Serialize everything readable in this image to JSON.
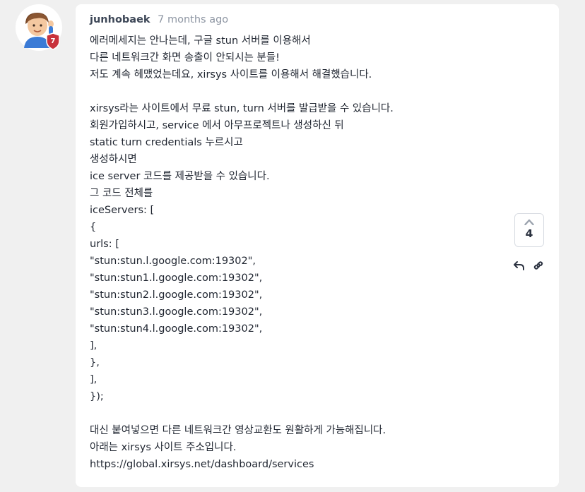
{
  "post": {
    "author": "junhobaek",
    "timestamp": "7 months ago",
    "avatar_badge": "7",
    "lines": [
      "에러메세지는 안나는데, 구글 stun 서버를 이용해서",
      "다른 네트워크간 화면 송출이 안되시는 분들!",
      "저도 계속 헤맸었는데요, xirsys 사이트를 이용해서 해결했습니다.",
      "",
      "xirsys라는 사이트에서 무료 stun, turn 서버를 발급받을 수 있습니다.",
      "회원가입하시고, service 에서 아무프로젝트나 생성하신 뒤",
      "static turn credentials 누르시고",
      "생성하시면",
      "ice server 코드를 제공받을 수 있습니다.",
      "그 코드 전체를",
      "iceServers: [",
      "{",
      "urls: [",
      "\"stun:stun.l.google.com:19302\",",
      "\"stun:stun1.l.google.com:19302\",",
      "\"stun:stun2.l.google.com:19302\",",
      "\"stun:stun3.l.google.com:19302\",",
      "\"stun:stun4.l.google.com:19302\",",
      "],",
      "},",
      "],",
      "});",
      "",
      "대신 붙여넣으면 다른 네트워크간 영상교환도 원활하게 가능해집니다.",
      "아래는 xirsys 사이트 주소입니다.",
      "https://global.xirsys.net/dashboard/services"
    ],
    "vote_count": "4",
    "icons": {
      "vote": "chevron-up-icon",
      "reply": "reply-icon",
      "link": "link-icon"
    },
    "colors": {
      "badge": "#c8323c",
      "text": "#1f2530",
      "muted": "#8e96a3"
    }
  }
}
